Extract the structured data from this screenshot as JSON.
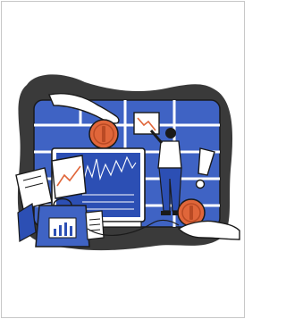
{
  "illustration": {
    "kind": "financial-analytics-illustration",
    "colors": {
      "backdrop": "#3a3a3a",
      "board": "#3f63c4",
      "board_panel": "#ffffff",
      "coin": "#e0663a",
      "coin_shadow": "#b94a24",
      "monitor_screen": "#2c4fb4",
      "person_shirt": "#ffffff",
      "person_pants": "#2c4fb4",
      "outline": "#1a1a1a",
      "accent_chart": "#e0663a"
    },
    "icons": [
      "hand-icon",
      "coin-icon",
      "chart-card-icon",
      "person-icon",
      "exclamation-icon",
      "monitor-icon",
      "bag-icon",
      "document-icon"
    ]
  }
}
